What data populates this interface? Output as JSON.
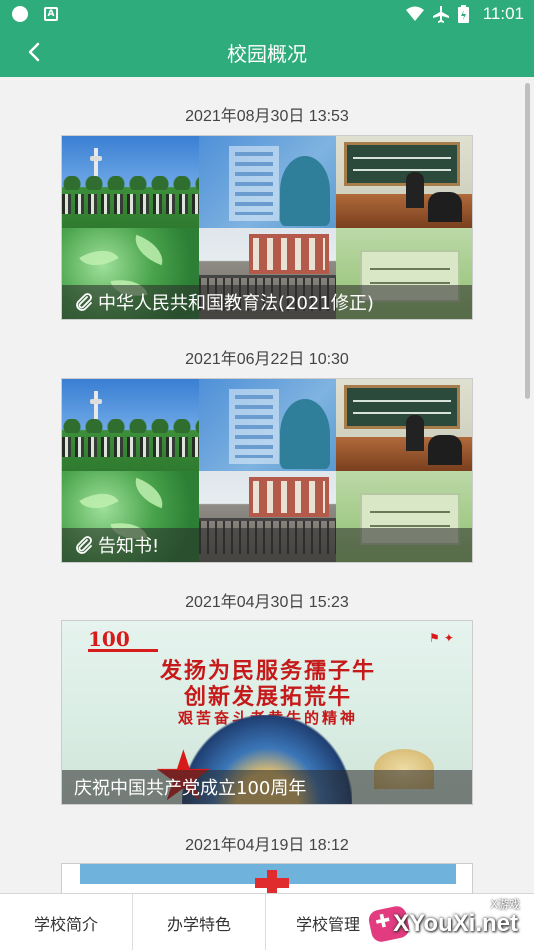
{
  "status_bar": {
    "time": "11:01",
    "left_icons": [
      "notification-dot-icon",
      "keyboard-a-icon"
    ],
    "right_icons": [
      "wifi-icon",
      "airplane-icon",
      "battery-icon"
    ],
    "a_glyph": "A"
  },
  "header": {
    "title": "校园概况",
    "back_icon": "chevron-left-icon",
    "color": "#2fac7c"
  },
  "posts": [
    {
      "date": "2021年08月30日 13:53",
      "caption": "中华人民共和国教育法(2021修正)",
      "attachment_icon": "paperclip-icon"
    },
    {
      "date": "2021年06月22日 10:30",
      "caption": "告知书!",
      "attachment_icon": "paperclip-icon"
    },
    {
      "date": "2021年04月30日 15:23",
      "caption": "庆祝中国共产党成立100周年",
      "banner": {
        "logo": "100",
        "line1": "发扬为民服务孺子牛",
        "line2": "创新发展拓荒牛",
        "line3": "艰苦奋斗老黄牛的精神"
      }
    },
    {
      "date": "2021年04月19日 18:12"
    }
  ],
  "bottom_nav": {
    "items": [
      "学校简介",
      "办学特色",
      "学校管理"
    ]
  },
  "watermark": {
    "text": "XYouXi.net",
    "small": "X游戏"
  }
}
